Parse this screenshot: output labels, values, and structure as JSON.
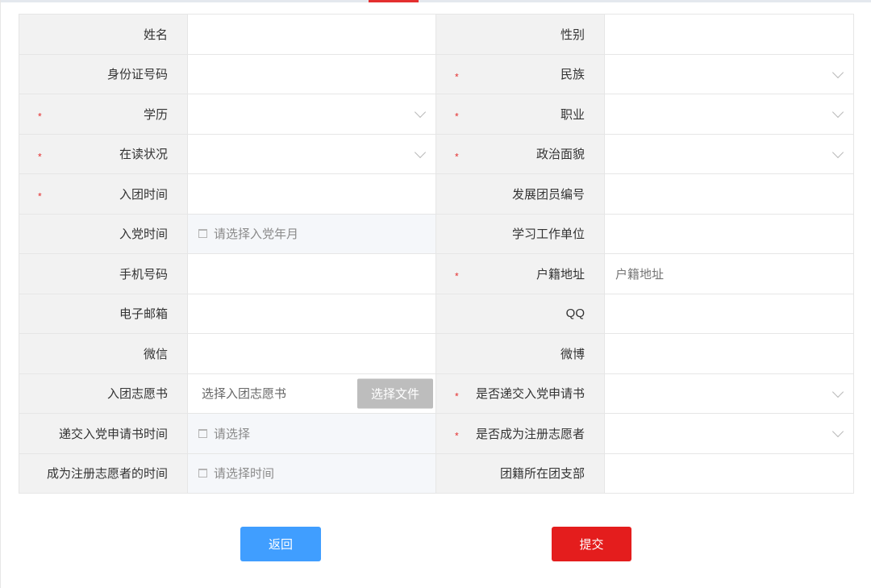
{
  "labels": {
    "name": "姓名",
    "gender": "性别",
    "id_number": "身份证号码",
    "ethnicity": "民族",
    "education": "学历",
    "occupation": "职业",
    "school_status": "在读状况",
    "political_status": "政治面貌",
    "league_join_time": "入团时间",
    "member_number": "发展团员编号",
    "party_join_time": "入党时间",
    "work_unit": "学习工作单位",
    "phone": "手机号码",
    "household_address": "户籍地址",
    "email": "电子邮箱",
    "qq": "QQ",
    "wechat": "微信",
    "weibo": "微博",
    "league_application": "入团志愿书",
    "submitted_party_application": "是否递交入党申请书",
    "party_application_time": "递交入党申请书时间",
    "registered_volunteer": "是否成为注册志愿者",
    "volunteer_time": "成为注册志愿者的时间",
    "branch": "团籍所在团支部"
  },
  "required_mark": "*",
  "placeholders": {
    "party_join_time": "请选择入党年月",
    "household_address": "户籍地址",
    "league_application": "选择入团志愿书",
    "party_application_time": "请选择",
    "volunteer_time": "请选择时间"
  },
  "buttons": {
    "choose_file": "选择文件",
    "back": "返回",
    "submit": "提交"
  },
  "colors": {
    "required": "#e42f2f",
    "back_button": "#409eff",
    "submit_button": "#e41d1d",
    "file_button": "#bdbdbd"
  }
}
